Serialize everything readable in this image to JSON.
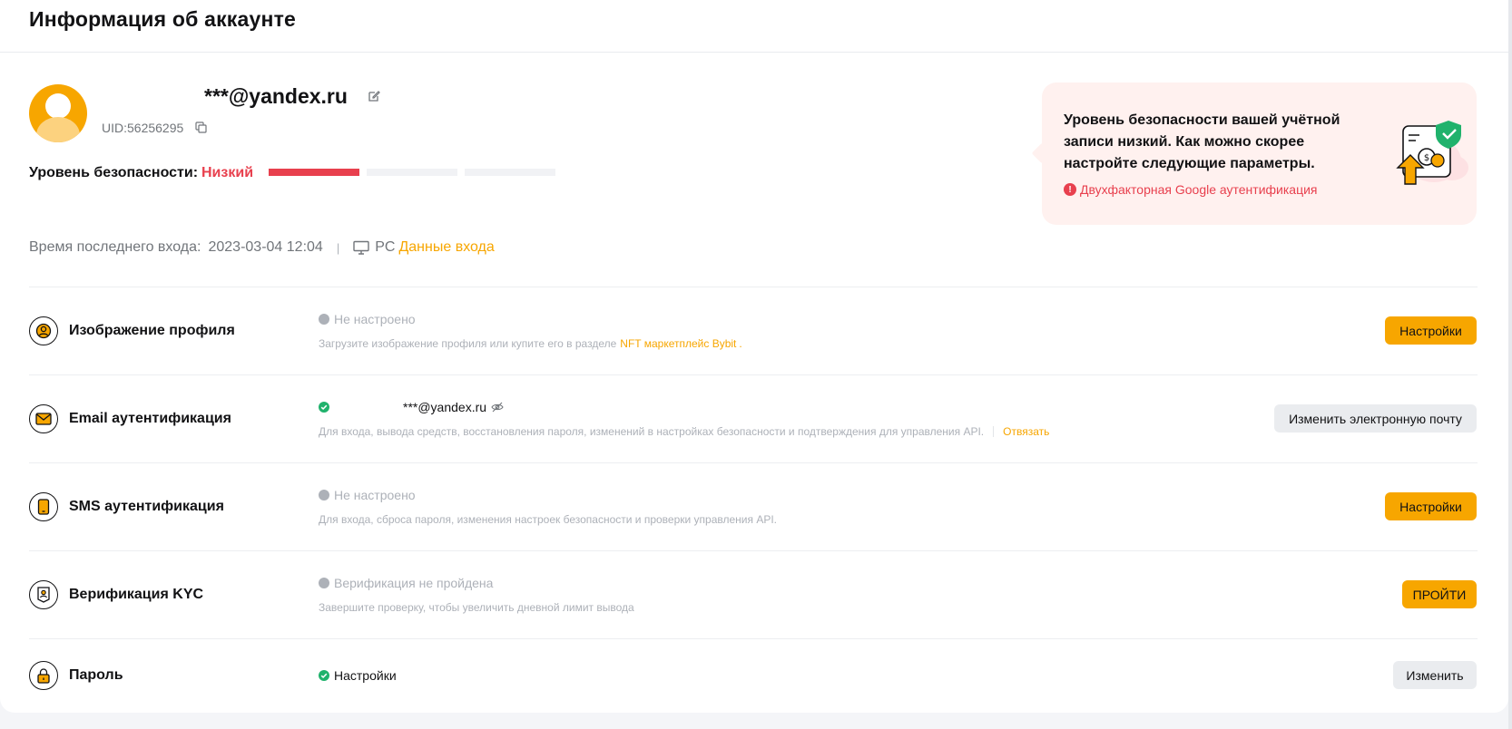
{
  "header": {
    "title": "Информация об аккаунте"
  },
  "profile": {
    "email": "***@yandex.ru",
    "uid": "UID:56256295",
    "security_label": "Уровень безопасности",
    "security_colon": ":",
    "security_value": "Низкий",
    "security_level_fraction": 0.333,
    "last_login_label": "Время последнего входа",
    "last_login_colon": ":",
    "last_login_time": "2023-03-04 12:04",
    "separator": "|",
    "device": "PC",
    "login_data_link": "Данные входа"
  },
  "alert": {
    "text": "Уровень безопасности вашей учётной записи низкий. Как можно скорее настройте следующие параметры.",
    "item": "Двухфакторная Google аутентификация",
    "item_icon": "!"
  },
  "rows": {
    "avatar": {
      "title": "Изображение профиля",
      "status": "Не настроено",
      "desc": "Загрузите изображение профиля или купите его в разделе",
      "desc_link": "NFT маркетплейс Bybit",
      "desc_tail": ".",
      "button": "Настройки"
    },
    "email": {
      "title": "Email аутентификация",
      "status": "***@yandex.ru",
      "desc": "Для входа, вывода средств, восстановления пароля, изменений в настройках безопасности и подтверждения для управления API.",
      "desc_link": "Отвязать",
      "button": "Изменить электронную почту"
    },
    "sms": {
      "title": "SMS аутентификация",
      "status": "Не настроено",
      "desc": "Для входа, сброса пароля, изменения настроек безопасности и проверки управления API.",
      "button": "Настройки"
    },
    "kyc": {
      "title": "Верификация KYC",
      "status": "Верификация не пройдена",
      "desc": "Завершите проверку, чтобы увеличить дневной лимит вывода",
      "button": "ПРОЙТИ"
    },
    "password": {
      "title": "Пароль",
      "status": "Настройки",
      "button": "Изменить"
    }
  },
  "colors": {
    "accent": "#f7a600",
    "danger": "#e8404e",
    "success": "#20b26c",
    "muted": "#adb1b8"
  }
}
